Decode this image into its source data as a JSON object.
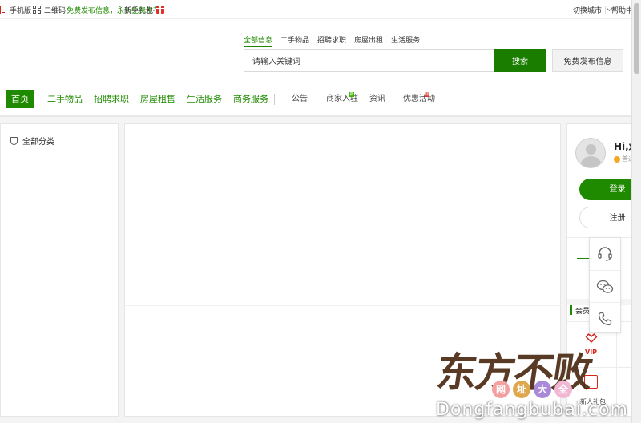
{
  "topbar": {
    "mobile_label": "手机版",
    "qr_label": "二维码",
    "promo_text": "免费发布信息，永久免费发布",
    "gift_label": "新手礼包",
    "city_label": "切换城市",
    "help_label": "帮助中心"
  },
  "search": {
    "tabs": [
      "全部信息",
      "二手物品",
      "招聘求职",
      "房屋出租",
      "生活服务"
    ],
    "active_tab": 0,
    "input_value": "请输入关键词",
    "button_label": "搜索",
    "publish_label": "免费发布信息"
  },
  "nav": {
    "home": "首页",
    "green_items": [
      "二手物品",
      "招聘求职",
      "房屋租售",
      "生活服务",
      "商务服务"
    ],
    "grey_items": [
      "公告",
      "商家入驻",
      "资讯",
      "优惠活动"
    ],
    "badges": {
      "merchant": "新",
      "promo": "热"
    }
  },
  "left": {
    "category_title": "全部分类",
    "icon": "shield-icon"
  },
  "user": {
    "greeting": "Hi,欢迎来到",
    "level_text": "普通会员",
    "login_label": "登录",
    "register_label": "注册",
    "section_title": "会员服务",
    "vip_label": "VIP",
    "gift_label": "新人礼包"
  },
  "float_bar": {
    "icons": [
      "headset-icon",
      "wechat-icon",
      "phone-icon"
    ]
  },
  "watermark": {
    "title": "东方不败",
    "dots": [
      "网",
      "址",
      "大",
      "全"
    ],
    "dot_colors": [
      "#f4a0a0",
      "#e0a84e",
      "#a98ad9",
      "#f2b7d2"
    ],
    "url": "Dongfangbubai.com"
  },
  "colors": {
    "accent": "#1f8a00",
    "badge_red": "#e0322a"
  }
}
